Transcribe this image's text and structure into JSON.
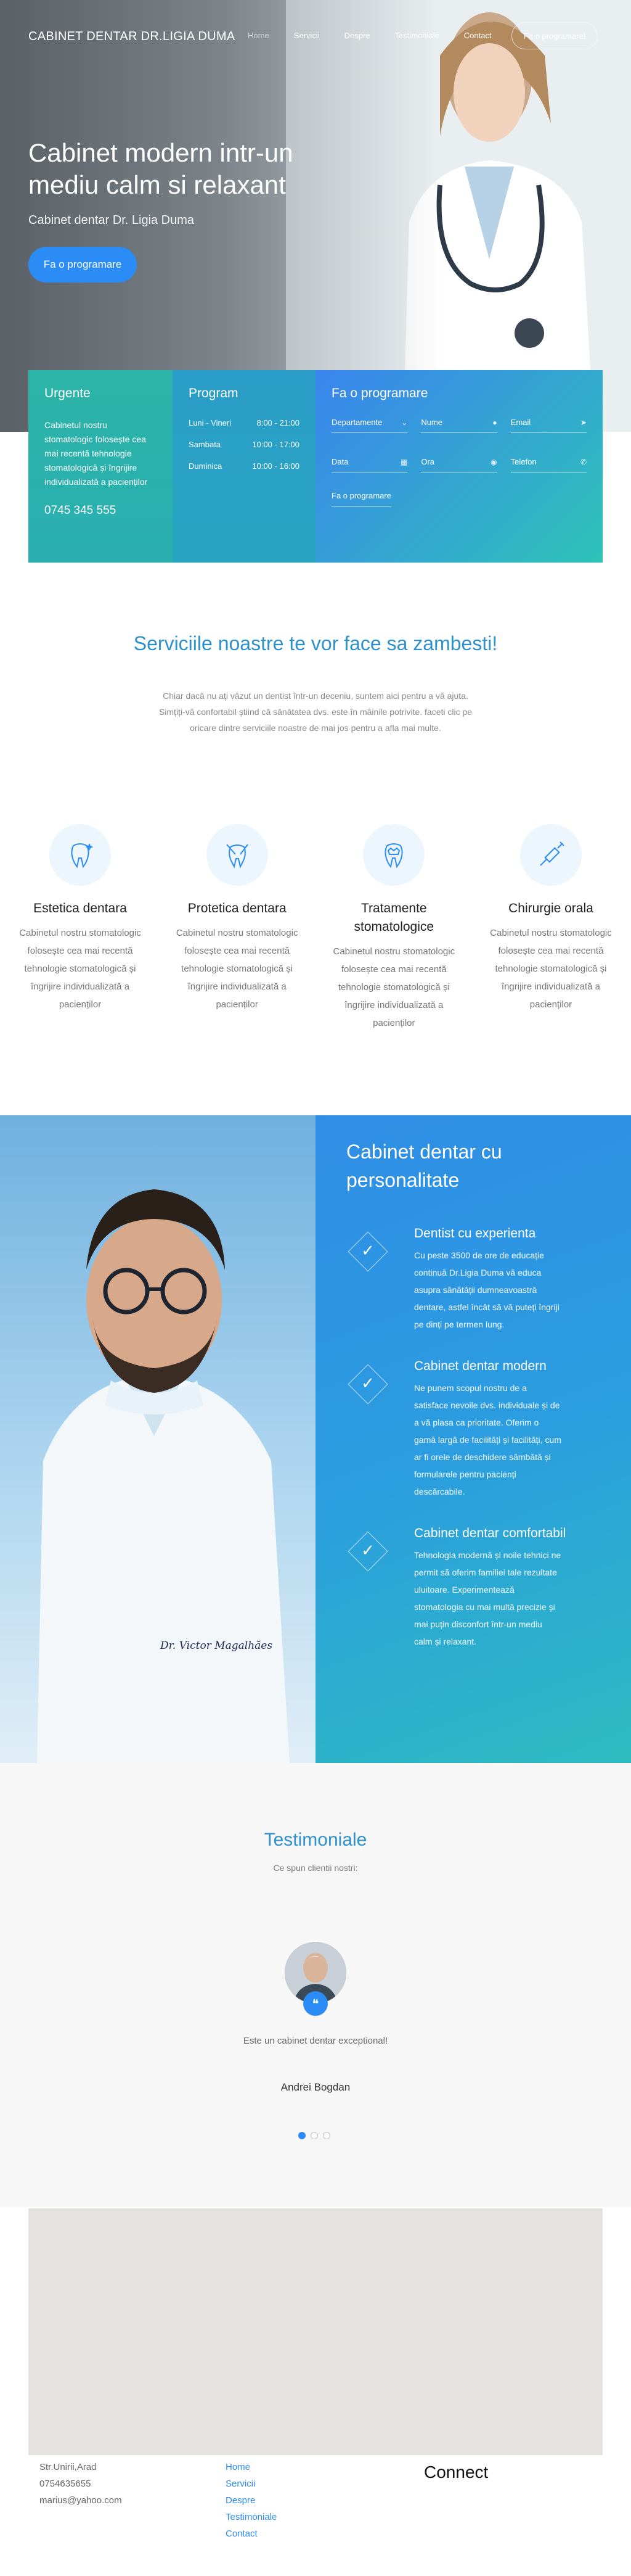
{
  "nav": {
    "brand": "CABINET DENTAR DR.LIGIA DUMA",
    "items": [
      "Home",
      "Servicii",
      "Despre",
      "Testimoniale",
      "Contact"
    ],
    "cta": "Fa o programare!"
  },
  "hero": {
    "title": "Cabinet modern intr-un mediu calm si relaxant",
    "subtitle": "Cabinet dentar Dr. Ligia Duma",
    "button": "Fa o programare"
  },
  "info": {
    "urgente": {
      "title": "Urgente",
      "text": "Cabinetul nostru stomatologic folosește cea mai recentă tehnologie stomatologică și îngrijire individualizată a pacienților",
      "phone": "0745 345 555"
    },
    "program": {
      "title": "Program",
      "rows": [
        {
          "day": "Luni - Vineri",
          "hours": "8:00 - 21:00"
        },
        {
          "day": "Sambata",
          "hours": "10:00 - 17:00"
        },
        {
          "day": "Duminica",
          "hours": "10:00 - 16:00"
        }
      ]
    },
    "form": {
      "title": "Fa o programare",
      "fields": [
        "Departamente",
        "Nume",
        "Email",
        "Data",
        "Ora",
        "Telefon"
      ],
      "button": "Fa o programare"
    }
  },
  "services": {
    "title": "Serviciile noastre te vor face sa zambesti!",
    "intro": "Chiar dacă nu ați văzut un dentist într-un deceniu, suntem aici pentru a vă ajuta. Simțiți-vă confortabil știind că sănătatea dvs. este în mâinile potrivite. faceti clic pe oricare dintre serviciile noastre de mai jos pentru a afla mai multe.",
    "items": [
      {
        "name": "Estetica dentara",
        "text": "Cabinetul nostru stomatologic folosește cea mai recentă tehnologie stomatologică și îngrijire individualizată a pacienților"
      },
      {
        "name": "Protetica dentara",
        "text": "Cabinetul nostru stomatologic folosește cea mai recentă tehnologie stomatologică și îngrijire individualizată a pacienților"
      },
      {
        "name": "Tratamente stomatologice",
        "text": "Cabinetul nostru stomatologic folosește cea mai recentă tehnologie stomatologică și îngrijire individualizată a pacienților"
      },
      {
        "name": "Chirurgie orala",
        "text": "Cabinetul nostru stomatologic folosește cea mai recentă tehnologie stomatologică și îngrijire individualizată a pacienților"
      }
    ]
  },
  "personality": {
    "title": "Cabinet dentar cu personalitate",
    "coat_text": "Dr. Victor Magalhães",
    "features": [
      {
        "title": "Dentist cu experienta",
        "text": "Cu peste 3500 de ore de educație continuă Dr.Ligia Duma vă educa asupra sănătății dumneavoastră dentare, astfel încât să vă puteți îngriji pe dinți pe termen lung."
      },
      {
        "title": "Cabinet dentar modern",
        "text": "Ne punem scopul nostru de a satisface nevoile dvs. individuale și de a vă plasa ca prioritate. Oferim o gamă largă de facilități și facilități, cum ar fi orele de deschidere sâmbătă și formularele pentru pacienți descărcabile."
      },
      {
        "title": "Cabinet dentar comfortabil",
        "text": "Tehnologia modernă și noile tehnici ne permit să oferim familiei tale rezultate uluitoare. Experimentează stomatologia cu mai multă precizie și mai puțin disconfort într-un mediu calm și relaxant."
      }
    ]
  },
  "testimonials": {
    "title": "Testimoniale",
    "subtitle": "Ce spun clientii nostri:",
    "quote_mark": "❝",
    "quote": "Este un cabinet dentar exceptional!",
    "author": "Andrei Bogdan"
  },
  "footer": {
    "address": [
      "Str.Unirii,Arad",
      "0754635655",
      "marius@yahoo.com"
    ],
    "links": [
      "Home",
      "Servicii",
      "Despre",
      "Testimoniale",
      "Contact"
    ],
    "connect": "Connect"
  },
  "colors": {
    "accent": "#2b8cf6",
    "teal": "#2bb4a7",
    "heading_blue": "#2d91cd"
  }
}
